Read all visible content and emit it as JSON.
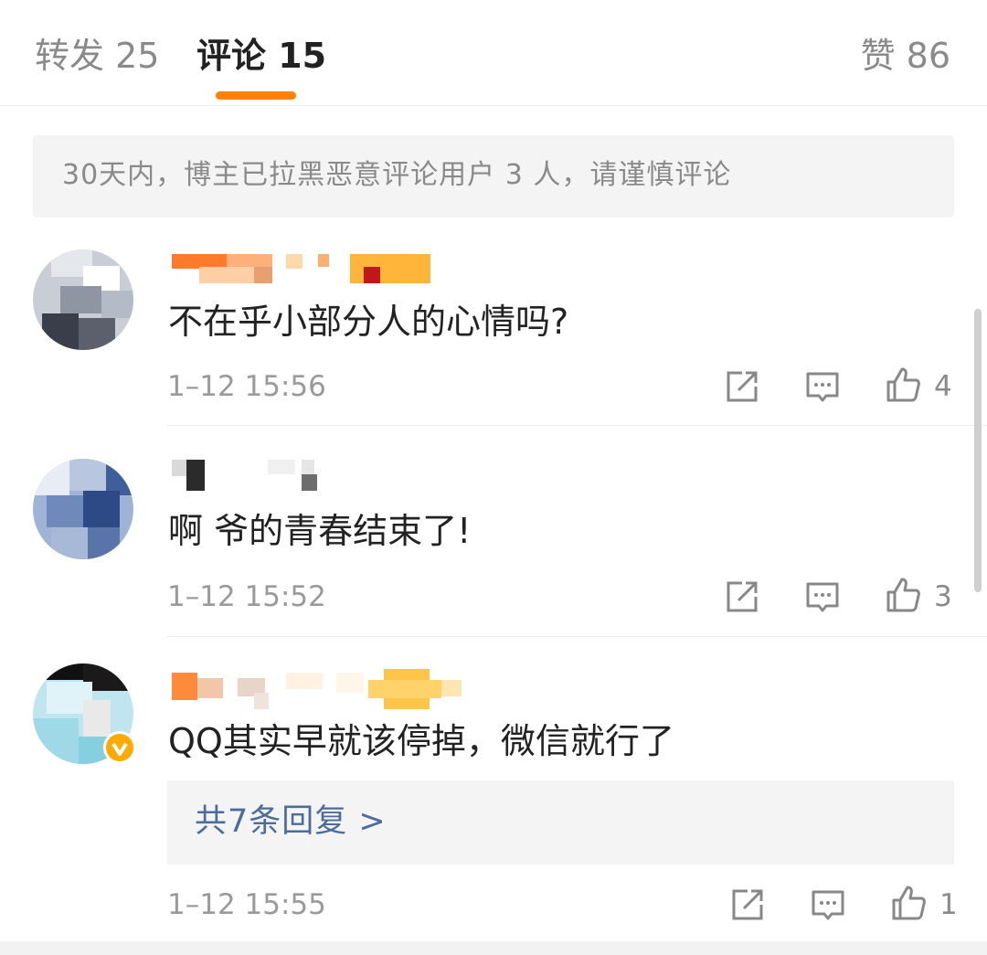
{
  "tabs": {
    "repost": "转发 25",
    "comment": "评论 15",
    "like": "赞 86"
  },
  "notice": "30天内，博主已拉黑恶意评论用户 3 人，请谨慎评论",
  "comments": [
    {
      "text": "不在乎小部分人的心情吗?",
      "time": "1–12 15:56",
      "likes": "4"
    },
    {
      "text": "啊 爷的青春结束了!",
      "time": "1–12 15:52",
      "likes": "3"
    },
    {
      "text": "QQ其实早就该停掉，微信就行了",
      "time": "1–12 15:55",
      "likes": "1",
      "replies": "共7条回复 >",
      "verified": true
    }
  ],
  "icons": {
    "share": "share-icon",
    "reply": "comment-icon",
    "like": "thumbs-up-icon"
  },
  "colors": {
    "accent": "#ff8200",
    "link": "#4a6d9b",
    "verified": "#ffaa00"
  }
}
